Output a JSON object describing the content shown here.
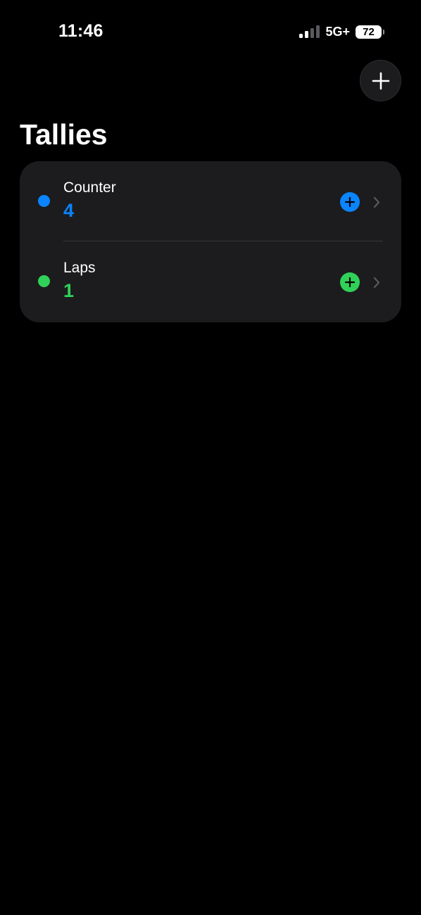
{
  "status_bar": {
    "time": "11:46",
    "network": "5G+",
    "battery": "72",
    "signal_bars_filled": 2,
    "signal_bars_total": 4
  },
  "header": {
    "title": "Tallies",
    "add_icon": "plus-icon"
  },
  "tallies": [
    {
      "name": "Counter",
      "count": "4",
      "color": "#0a84ff",
      "increment_icon": "plus-circle-icon",
      "chevron_icon": "chevron-right-icon"
    },
    {
      "name": "Laps",
      "count": "1",
      "color": "#30d158",
      "increment_icon": "plus-circle-icon",
      "chevron_icon": "chevron-right-icon"
    }
  ],
  "colors": {
    "background": "#000000",
    "card": "#1c1c1e",
    "divider": "#38383a",
    "chevron": "#5a5a5e"
  }
}
